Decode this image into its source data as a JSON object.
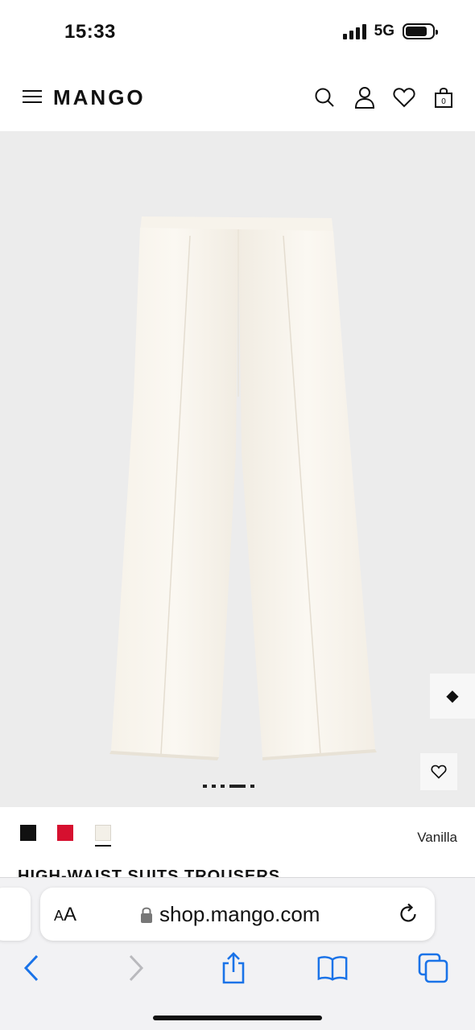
{
  "status_bar": {
    "time": "15:33",
    "network": "5G",
    "battery_level": 0.8
  },
  "header": {
    "logo": "MANGO",
    "icons": [
      "menu-icon",
      "search-icon",
      "account-icon",
      "wishlist-icon",
      "bag-icon"
    ],
    "bag_count": "0"
  },
  "gallery": {
    "image_count": 5,
    "active_index": 3
  },
  "product": {
    "colors": [
      {
        "name": "Black",
        "hex": "#111111"
      },
      {
        "name": "Red",
        "hex": "#d6102f"
      },
      {
        "name": "Vanilla",
        "hex": "#f3f0e8"
      }
    ],
    "selected_color": "Vanilla",
    "title": "HIGH-WAIST SUITS TROUSERS"
  },
  "browser": {
    "aa_label": "AA",
    "url": "shop.mango.com",
    "accent": "#1a73e8"
  }
}
